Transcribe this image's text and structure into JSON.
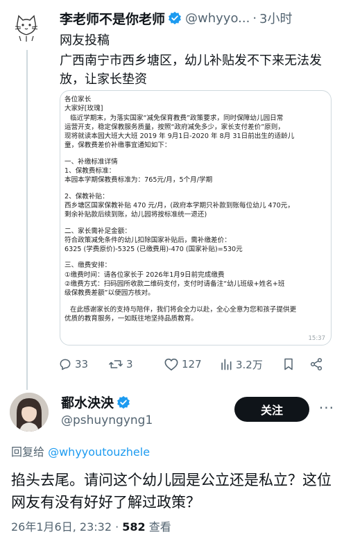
{
  "parent_tweet": {
    "author_name": "李老师不是你老师",
    "handle": "@whyyo...",
    "separator": "·",
    "time": "3小时",
    "more": "···",
    "source_label": "网友投稿",
    "body": "广西南宁市西乡塘区，幼儿补贴发不下来无法发放，让家长垫资",
    "image": {
      "lines": [
        "各位家长",
        "大家好[玫瑰]",
        "临近学期末，为落实国家“减免保育教费”政策要求，同时保障幼儿园日常",
        "运营开支，稳定保教服务质量，按照“政府减免多少，家长支付差价”原则，",
        "现将就读本园大班大大班 2019 年 9月1日-2020 年 8月 31日前出生的适龄儿",
        "童，保教费差价补缴事宜通知如下：",
        "",
        "一、补缴标准详情",
        "1、保教费标准：",
        "本园本学期保教费标准为：765元/月，5个月/学期",
        "",
        "2、保教补贴：",
        "西乡塘区国家保教补贴 470 元/月，(政府本学期只补款到账每位幼儿 470元，",
        "剩余补贴款后续到账，幼儿园将按标准统一退还)",
        "",
        "二、家长需补足金额：",
        "符合政策减免条件的幼儿扣除国家补贴后，需补缴差价：",
        "6325 (学费原价)-5325 (已缴费用)-470 (国家补贴)=530元",
        "",
        "三、缴费安排：",
        "①缴费时间：请各位家长于 2026年1月9日前完成缴费",
        "②缴费方式：扫码园所收款二维码支付，支付时请备注“幼儿班级+姓名+班",
        "级保教费差额”以便园方核对。",
        "",
        "在此感谢家长的支持与陪伴，我们将会全力以赴，全心全意为您和孩子提供更",
        "优质的教育服务，一如既往地坚持品质教育。"
      ],
      "timestamp": "15:37"
    },
    "stats": {
      "replies": "33",
      "reposts": "3",
      "likes": "127",
      "views": "3.2万"
    }
  },
  "reply_tweet": {
    "author_name": "鄱水泱泱",
    "handle": "@pshuyngyng1",
    "follow_label": "关注",
    "more": "···",
    "replying_prefix": "回复给 ",
    "replying_to": "@whyyoutouzhele",
    "text": "掐头去尾。请问这个幼儿园是公立还是私立？这位网友有没有好好了解过政策？",
    "date": "26年1月6日, 23:32 · ",
    "views_count": "582",
    "views_label": " 查看"
  },
  "colors": {
    "verified": "#1d9bf0",
    "secondary_text": "#536471",
    "link": "#1d9bf0",
    "follow_button_bg": "#0f1419"
  },
  "icons": [
    "reply-icon",
    "repost-icon",
    "like-icon",
    "views-icon",
    "bookmark-icon",
    "share-icon",
    "verified-badge-icon",
    "cat-avatar",
    "user-avatar"
  ]
}
